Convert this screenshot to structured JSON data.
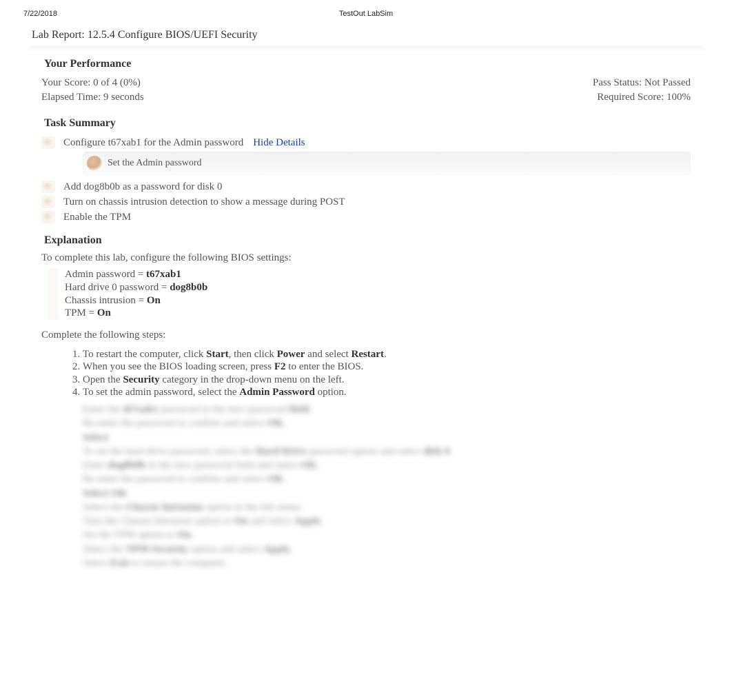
{
  "header": {
    "date": "7/22/2018",
    "app": "TestOut LabSim"
  },
  "report": {
    "title": "Lab Report: 12.5.4 Configure BIOS/UEFI Security"
  },
  "performance": {
    "heading": "Your Performance",
    "score_label": "Your Score: 0 of 4 (0%)",
    "pass_status": "Pass Status: Not Passed",
    "elapsed": "Elapsed Time: 9 seconds",
    "required": "Required Score: 100%"
  },
  "task_summary": {
    "heading": "Task Summary",
    "items": [
      {
        "text": "Configure t67xab1 for the Admin password",
        "details_link": "Hide Details"
      },
      {
        "text": "Add dog8b0b as a password for disk 0"
      },
      {
        "text": "Turn on chassis intrusion detection to show a message during POST"
      },
      {
        "text": "Enable the TPM"
      }
    ],
    "subtask": "Set the Admin password"
  },
  "explanation": {
    "heading": "Explanation",
    "intro": "To complete this lab, configure the following BIOS settings:",
    "settings": {
      "admin_pw_label": "Admin password = ",
      "admin_pw_value": "t67xab1",
      "hd_pw_label": "Hard drive 0 password = ",
      "hd_pw_value": "dog8b0b",
      "chassis_label": "Chassis intrusion = ",
      "chassis_value": "On",
      "tpm_label": "TPM = ",
      "tpm_value": "On"
    },
    "steps_intro": "Complete the following steps:",
    "steps": {
      "s1_a": "To restart the computer, click ",
      "s1_b": "Start",
      "s1_c": ", then click ",
      "s1_d": "Power",
      "s1_e": " and select ",
      "s1_f": "Restart",
      "s1_g": ".",
      "s2_a": "When you see the BIOS loading screen, press ",
      "s2_b": "F2",
      "s2_c": " to enter the BIOS.",
      "s3_a": "Open the ",
      "s3_b": "Security",
      "s3_c": " category in the drop-down menu on the left.",
      "s4_a": "To set the admin password, select the ",
      "s4_b": "Admin Password",
      "s4_c": " option."
    }
  }
}
